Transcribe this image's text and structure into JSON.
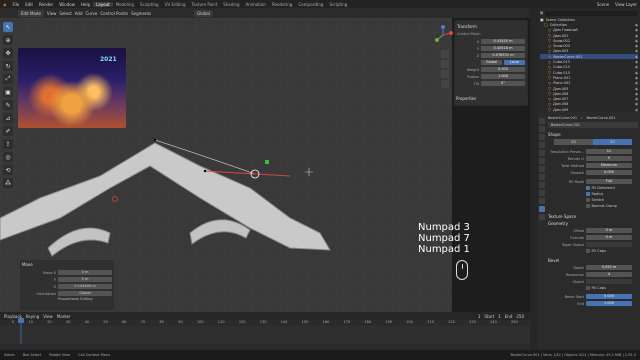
{
  "topbar": {
    "menus": [
      "File",
      "Edit",
      "Render",
      "Window",
      "Help"
    ],
    "workspaces": [
      "Layout",
      "Modeling",
      "Sculpting",
      "UV Editing",
      "Texture Paint",
      "Shading",
      "Animation",
      "Rendering",
      "Compositing",
      "Scripting"
    ],
    "active_workspace": "Layout",
    "scene": "Scene",
    "view_layer": "View Layer"
  },
  "viewport_header": {
    "mode": "Edit Mode",
    "menus": [
      "View",
      "Select",
      "Add",
      "Curve",
      "Control Points",
      "Segments"
    ],
    "orientation": "Global"
  },
  "reference_image": {
    "label": "2021"
  },
  "overlay_text": [
    "Numpad 3",
    "Numpad 7",
    "Numpad 1"
  ],
  "transform_panel": {
    "title": "Transform",
    "subtitle": "Control Point:",
    "x": "0.43455 m",
    "y": "0.40518 m",
    "z": "0.076531 m",
    "space_global": "Global",
    "space_local": "Local",
    "weight_label": "Weight",
    "weight": "0.000",
    "radius_label": "Radius",
    "radius": "1.000",
    "tilt_label": "Tilt",
    "tilt": "0°"
  },
  "properties_collapsed": "Properties",
  "last_operator": {
    "title": "Move",
    "move_x_label": "Move X",
    "move_x": "0 m",
    "y_label": "Y",
    "y": "0 m",
    "z_label": "Z",
    "z": "0.124495 m",
    "orientation_label": "Orientation",
    "orientation": "Global",
    "proportional": "Proportional Editing"
  },
  "timeline": {
    "menus": [
      "Playback",
      "Keying",
      "View",
      "Marker"
    ],
    "frame": "1",
    "start_label": "Start",
    "start": "1",
    "end_label": "End",
    "end": "250",
    "ticks": [
      "0",
      "10",
      "20",
      "30",
      "40",
      "50",
      "60",
      "70",
      "80",
      "90",
      "100",
      "110",
      "120",
      "130",
      "140",
      "150",
      "160",
      "170",
      "180",
      "190",
      "200",
      "210",
      "220",
      "230",
      "240",
      "250"
    ]
  },
  "statusbar": {
    "left": [
      "Select",
      "Box Select",
      "Rotate View",
      "Call Context Menu"
    ],
    "right": "BezierCurve.001 | Verts 1/42 | Objects 0/24 | Memory: 49.1 MiB | 2.91.0"
  },
  "outliner": {
    "title": "Scene Collection",
    "items": [
      {
        "name": "Collection",
        "icon": "collection-icon",
        "selected": false
      },
      {
        "name": "Дом Главный",
        "icon": "mesh-icon",
        "selected": false
      },
      {
        "name": "Дом.001",
        "icon": "mesh-icon",
        "selected": false
      },
      {
        "name": "Snow.002",
        "icon": "mesh-icon",
        "selected": false
      },
      {
        "name": "Snow.003",
        "icon": "mesh-icon",
        "selected": false
      },
      {
        "name": "Дом.003",
        "icon": "mesh-icon",
        "selected": false
      },
      {
        "name": "BezierCurve.001",
        "icon": "curve-icon",
        "selected": true
      },
      {
        "name": "Cube.013",
        "icon": "mesh-icon",
        "selected": false
      },
      {
        "name": "Cube.014",
        "icon": "mesh-icon",
        "selected": false
      },
      {
        "name": "Cube.015",
        "icon": "mesh-icon",
        "selected": false
      },
      {
        "name": "Plane.001",
        "icon": "mesh-icon",
        "selected": false
      },
      {
        "name": "Plane.002",
        "icon": "mesh-icon",
        "selected": false
      },
      {
        "name": "Дом.005",
        "icon": "mesh-icon",
        "selected": false
      },
      {
        "name": "Дом.006",
        "icon": "mesh-icon",
        "selected": false
      },
      {
        "name": "Дом.007",
        "icon": "mesh-icon",
        "selected": false
      },
      {
        "name": "Дом.008",
        "icon": "mesh-icon",
        "selected": false
      },
      {
        "name": "Дом.009",
        "icon": "mesh-icon",
        "selected": false
      }
    ]
  },
  "properties": {
    "breadcrumb": [
      "BezierCurve.001",
      "BezierCurve.001"
    ],
    "datablock": "BezierCurve.001",
    "shape_title": "Shape",
    "dim_2d": "2D",
    "dim_3d": "3D",
    "resolution_preview_label": "Resolution Previe...",
    "resolution_preview": "12",
    "render_u_label": "Render U",
    "render_u": "0",
    "twist_method_label": "Twist Method",
    "twist_method": "Minimum",
    "smooth_label": "Smooth",
    "smooth": "0.000",
    "fill_mode_label": "Fill Mode",
    "fill_mode": "Full",
    "fill_deformed": "Fill Deformed",
    "radius": "Radius",
    "stretch": "Stretch",
    "bounds_clamp": "Bounds Clamp",
    "texture_space": "Texture Space",
    "geometry": "Geometry",
    "offset_label": "Offset",
    "offset": "0 m",
    "extrude_label": "Extrude",
    "extrude": "0 m",
    "taper_label": "Taper Object",
    "fill_caps": "Fill Caps",
    "bevel": "Bevel",
    "depth_label": "Depth",
    "depth": "0.055 m",
    "resolution_label": "Resolution",
    "resolution": "4",
    "object_label": "Object",
    "fill_caps2": "Fill Caps",
    "bevel_start_label": "Bevel Start",
    "bevel_start": "0.000",
    "end_label": "End",
    "end": "1.000"
  },
  "colors": {
    "accent": "#4772b3",
    "curve_orange": "#e49a3a",
    "viewport_bg": "#393939"
  }
}
